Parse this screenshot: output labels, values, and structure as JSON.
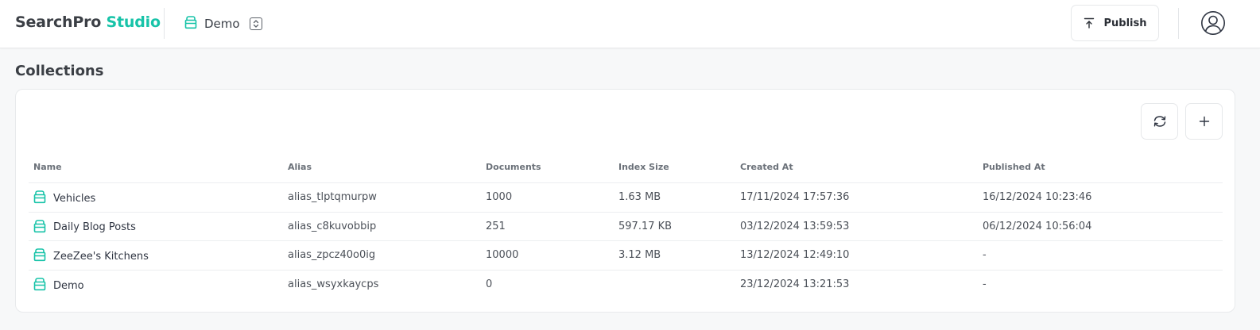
{
  "header": {
    "brand_primary": "SearchPro",
    "brand_accent": "Studio",
    "project_name": "Demo",
    "publish_label": "Publish"
  },
  "colors": {
    "accent": "#17c3a8",
    "text": "#2f3542",
    "muted": "#6b7179"
  },
  "page": {
    "title": "Collections"
  },
  "toolbar": {
    "refresh_icon": "refresh-icon",
    "add_icon": "plus-icon"
  },
  "table": {
    "columns": [
      "Name",
      "Alias",
      "Documents",
      "Index Size",
      "Created At",
      "Published At"
    ],
    "rows": [
      {
        "name": "Vehicles",
        "alias": "alias_tlptqmurpw",
        "documents": "1000",
        "index_size": "1.63 MB",
        "created_at": "17/11/2024 17:57:36",
        "published_at": "16/12/2024 10:23:46"
      },
      {
        "name": "Daily Blog Posts",
        "alias": "alias_c8kuvobbip",
        "documents": "251",
        "index_size": "597.17 KB",
        "created_at": "03/12/2024 13:59:53",
        "published_at": "06/12/2024 10:56:04"
      },
      {
        "name": "ZeeZee's Kitchens",
        "alias": "alias_zpcz40o0ig",
        "documents": "10000",
        "index_size": "3.12 MB",
        "created_at": "13/12/2024 12:49:10",
        "published_at": "-"
      },
      {
        "name": "Demo",
        "alias": "alias_wsyxkaycps",
        "documents": "0",
        "index_size": "",
        "created_at": "23/12/2024 13:21:53",
        "published_at": "-"
      }
    ]
  }
}
